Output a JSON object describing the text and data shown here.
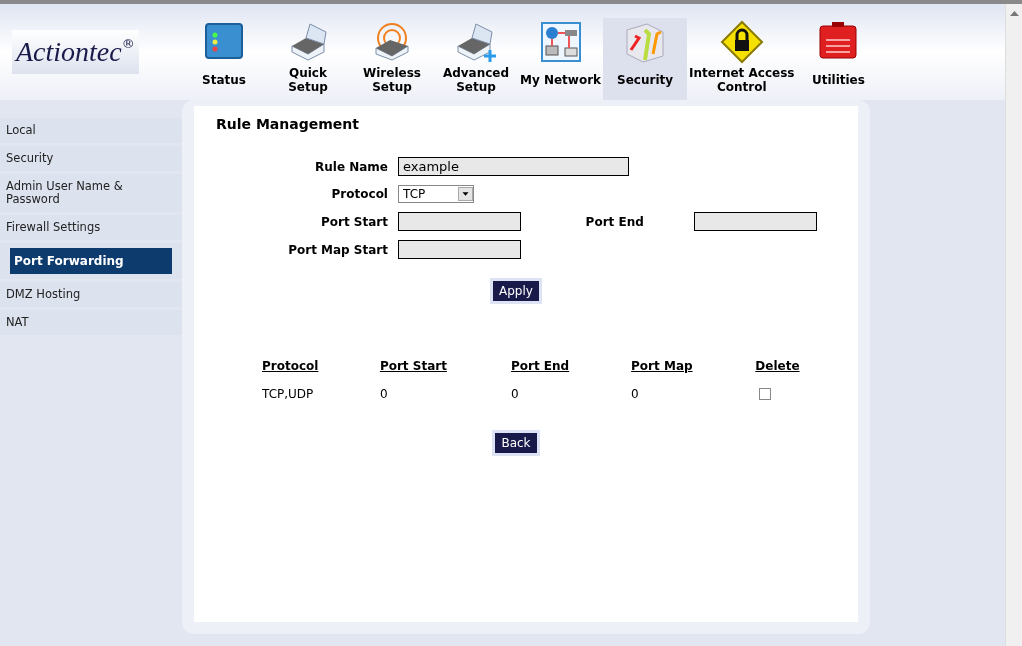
{
  "logo": {
    "name": "Actiontec",
    "mark": "®"
  },
  "nav": [
    {
      "kind": "status",
      "label": [
        "Status"
      ],
      "selected": false
    },
    {
      "kind": "setup",
      "label": [
        "Quick",
        "Setup"
      ],
      "selected": false
    },
    {
      "kind": "wireless",
      "label": [
        "Wireless",
        "Setup"
      ],
      "selected": false
    },
    {
      "kind": "advanced",
      "label": [
        "Advanced",
        "Setup"
      ],
      "selected": false
    },
    {
      "kind": "network",
      "label": [
        "My Network"
      ],
      "selected": false
    },
    {
      "kind": "security",
      "label": [
        "Security"
      ],
      "selected": true
    },
    {
      "kind": "lock",
      "label": [
        "Internet Access",
        "Control"
      ],
      "selected": false
    },
    {
      "kind": "toolbox",
      "label": [
        "Utilities"
      ],
      "selected": false
    }
  ],
  "sidebar": {
    "items": [
      {
        "label": "Local",
        "selected": false
      },
      {
        "label": "Security",
        "selected": false
      },
      {
        "label": "Admin User Name & Password",
        "selected": false
      },
      {
        "label": "Firewall Settings",
        "selected": false
      },
      {
        "label": "Port Forwarding",
        "selected": true
      },
      {
        "label": "DMZ Hosting",
        "selected": false
      },
      {
        "label": "NAT",
        "selected": false
      }
    ]
  },
  "form": {
    "title": "Rule Management",
    "rule_name": {
      "label": "Rule Name",
      "value": "example"
    },
    "protocol": {
      "label": "Protocol",
      "value": "TCP"
    },
    "port_start": {
      "label": "Port Start"
    },
    "port_end": {
      "label": "Port End"
    },
    "port_map_start": {
      "label": "Port Map Start"
    },
    "apply": "Apply"
  },
  "table": {
    "columns": [
      "Protocol",
      "Port Start",
      "Port End",
      "Port Map",
      "Delete"
    ],
    "rows": [
      {
        "cells": [
          "TCP,UDP",
          "0",
          "0",
          "0"
        ],
        "checked": false
      }
    ]
  },
  "back": "Back"
}
